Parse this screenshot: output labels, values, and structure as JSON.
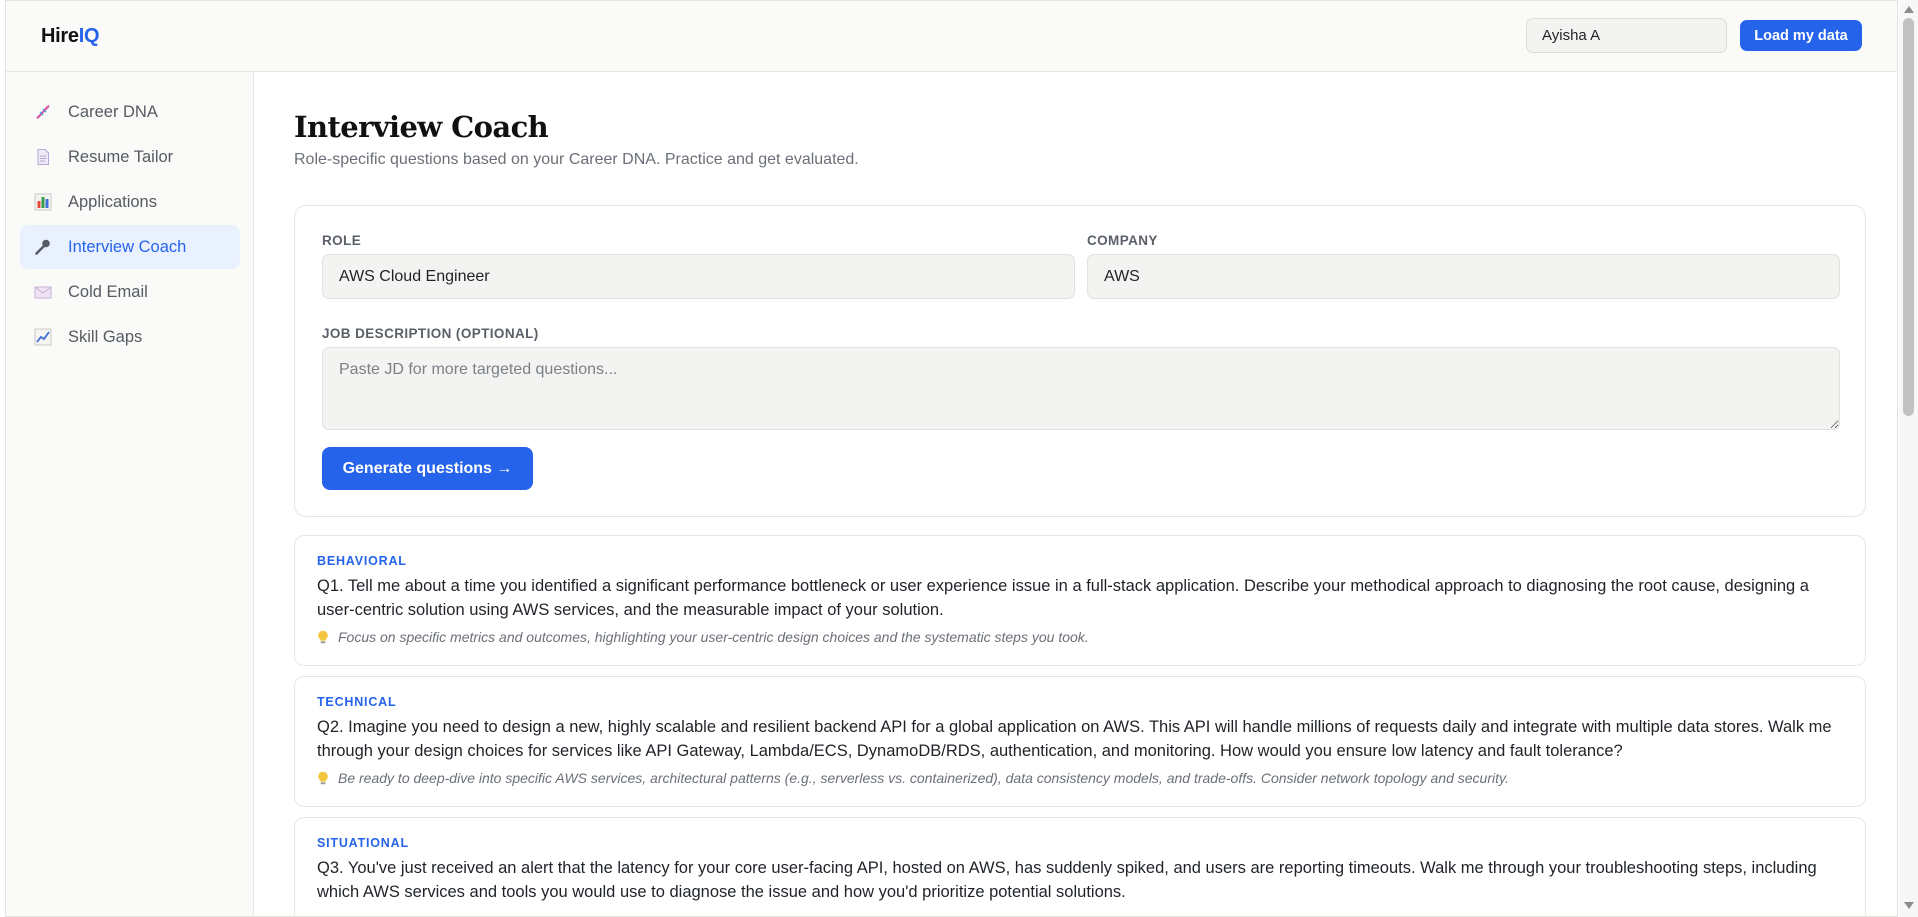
{
  "header": {
    "logo_part1": "Hire",
    "logo_part2": "IQ",
    "user_name": "Ayisha A",
    "load_button": "Load my data"
  },
  "sidebar": {
    "items": [
      {
        "label": "Career DNA",
        "icon": "dna-icon",
        "active": false
      },
      {
        "label": "Resume Tailor",
        "icon": "document-icon",
        "active": false
      },
      {
        "label": "Applications",
        "icon": "bar-chart-icon",
        "active": false
      },
      {
        "label": "Interview Coach",
        "icon": "microphone-icon",
        "active": true
      },
      {
        "label": "Cold Email",
        "icon": "envelope-icon",
        "active": false
      },
      {
        "label": "Skill Gaps",
        "icon": "line-chart-icon",
        "active": false
      }
    ]
  },
  "main": {
    "title": "Interview Coach",
    "subtitle": "Role-specific questions based on your Career DNA. Practice and get evaluated.",
    "form": {
      "role_label": "ROLE",
      "role_value": "AWS Cloud Engineer",
      "company_label": "COMPANY",
      "company_value": "AWS",
      "jd_label": "JOB DESCRIPTION (OPTIONAL)",
      "jd_placeholder": "Paste JD for more targeted questions...",
      "generate_button": "Generate questions →"
    },
    "questions": [
      {
        "category": "BEHAVIORAL",
        "text": "Q1. Tell me about a time you identified a significant performance bottleneck or user experience issue in a full-stack application. Describe your methodical approach to diagnosing the root cause, designing a user-centric solution using AWS services, and the measurable impact of your solution.",
        "tip": "Focus on specific metrics and outcomes, highlighting your user-centric design choices and the systematic steps you took."
      },
      {
        "category": "TECHNICAL",
        "text": "Q2. Imagine you need to design a new, highly scalable and resilient backend API for a global application on AWS. This API will handle millions of requests daily and integrate with multiple data stores. Walk me through your design choices for services like API Gateway, Lambda/ECS, DynamoDB/RDS, authentication, and monitoring. How would you ensure low latency and fault tolerance?",
        "tip": "Be ready to deep-dive into specific AWS services, architectural patterns (e.g., serverless vs. containerized), data consistency models, and trade-offs. Consider network topology and security."
      },
      {
        "category": "SITUATIONAL",
        "text": "Q3. You've just received an alert that the latency for your core user-facing API, hosted on AWS, has suddenly spiked, and users are reporting timeouts. Walk me through your troubleshooting steps, including which AWS services and tools you would use to diagnose the issue and how you'd prioritize potential solutions.",
        "tip": ""
      }
    ]
  },
  "colors": {
    "accent": "#2563eb",
    "active_nav_bg": "#eaf1fe",
    "sidebar_bg": "#fafaf8"
  }
}
